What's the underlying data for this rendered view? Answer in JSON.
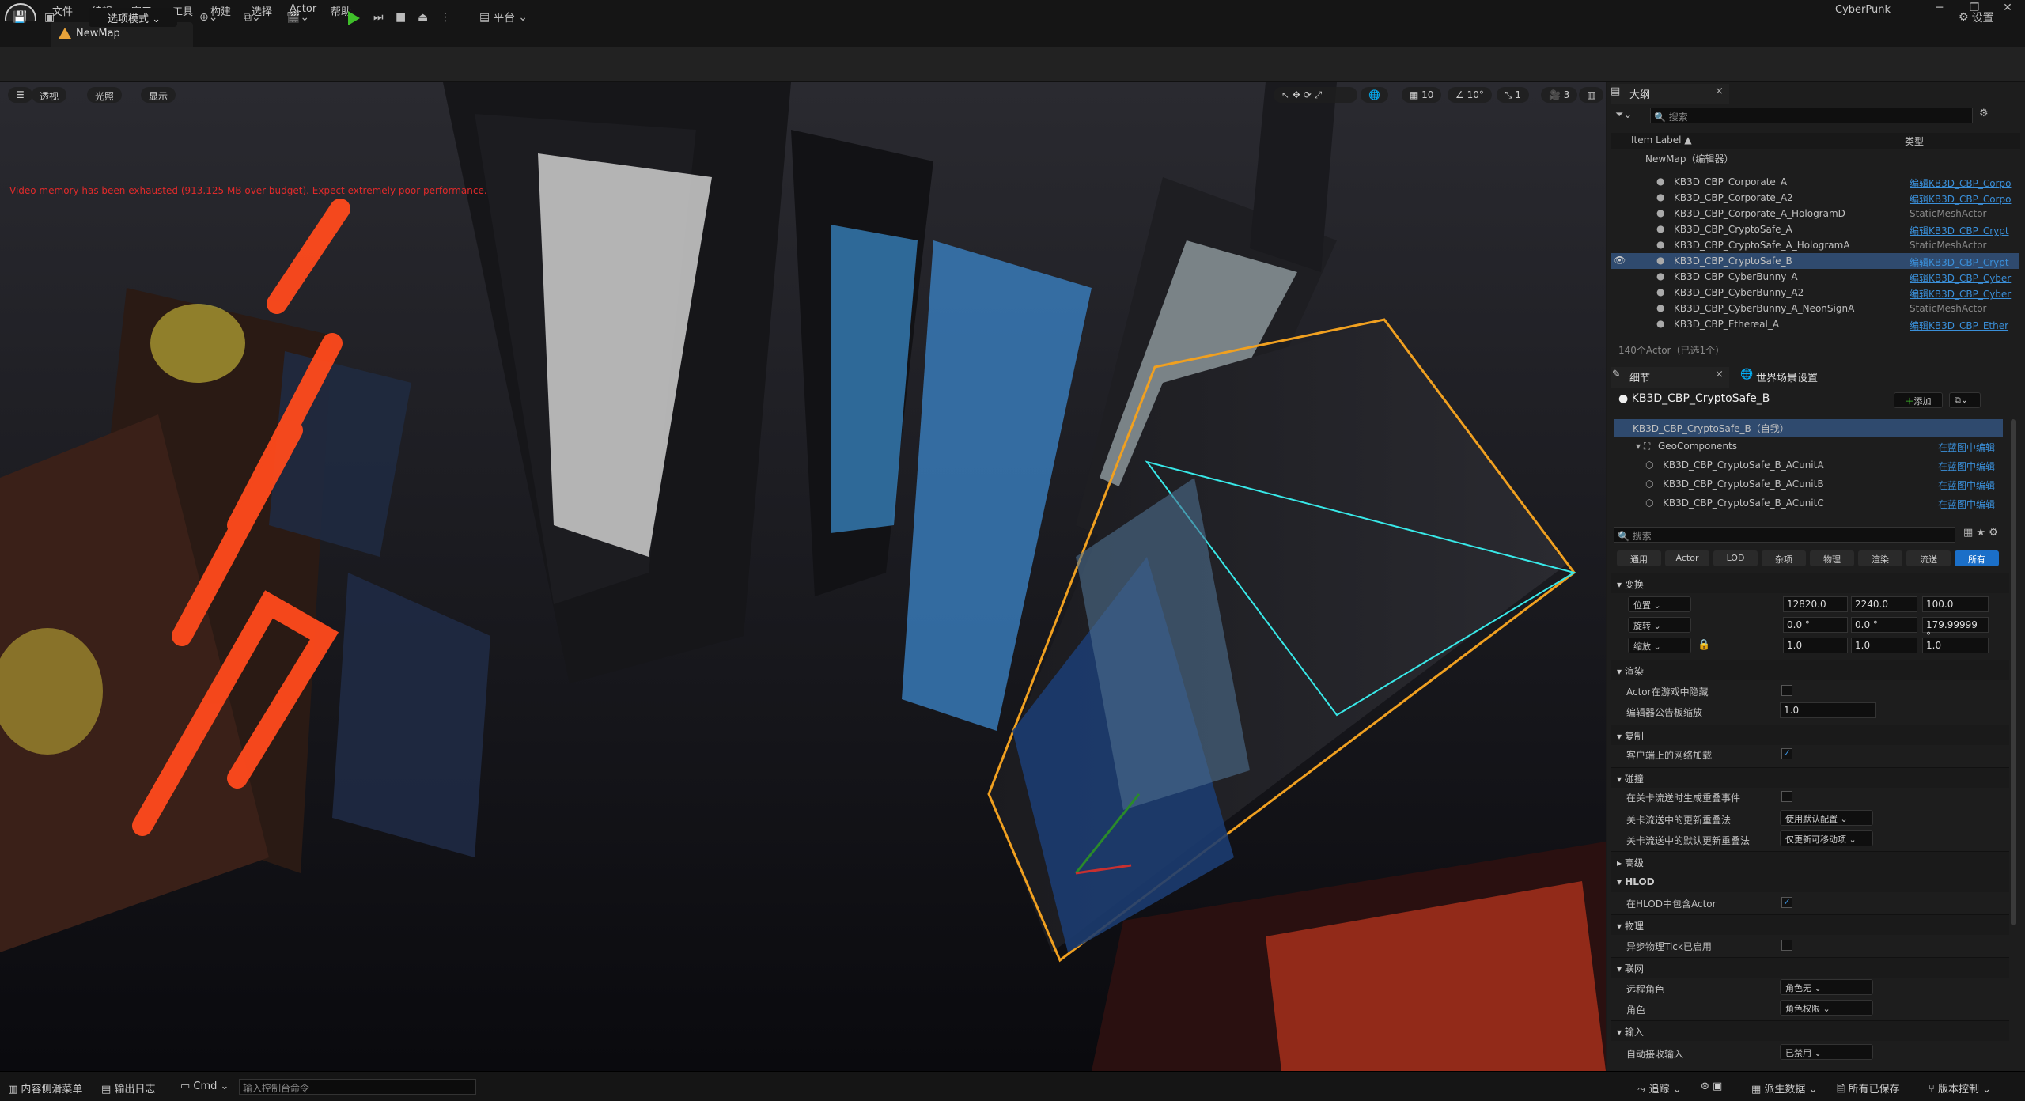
{
  "app": {
    "window_title": "CyberPunk",
    "map_tab": "NewMap"
  },
  "menu": [
    "文件",
    "编辑",
    "窗口",
    "工具",
    "构建",
    "选择",
    "Actor",
    "帮助"
  ],
  "window_buttons": [
    "─",
    "❐",
    "✕"
  ],
  "toolbar": {
    "mode_label": "选项模式",
    "platform_label": "平台",
    "settings_label": "设置"
  },
  "viewport": {
    "perspective": "透视",
    "lit": "光照",
    "show": "显示",
    "grid_snap": "10",
    "rot_snap": "10°",
    "scale_snap": "1",
    "cam_speed": "3",
    "warning": "Video memory has been exhausted (913.125 MB over budget). Expect extremely poor performance."
  },
  "outliner": {
    "title": "大纲",
    "search_placeholder": "搜索",
    "col_label": "Item Label ▲",
    "col_type": "类型",
    "root": "NewMap（编辑器）",
    "rows": [
      {
        "label": "KB3D_CBP_Corporate_A",
        "type": "编辑KB3D_CBP_Corpo",
        "link": true,
        "sel": false
      },
      {
        "label": "KB3D_CBP_Corporate_A2",
        "type": "编辑KB3D_CBP_Corpo",
        "link": true,
        "sel": false
      },
      {
        "label": "KB3D_CBP_Corporate_A_HologramD",
        "type": "StaticMeshActor",
        "link": false,
        "sel": false
      },
      {
        "label": "KB3D_CBP_CryptoSafe_A",
        "type": "编辑KB3D_CBP_Crypt",
        "link": true,
        "sel": false
      },
      {
        "label": "KB3D_CBP_CryptoSafe_A_HologramA",
        "type": "StaticMeshActor",
        "link": false,
        "sel": false
      },
      {
        "label": "KB3D_CBP_CryptoSafe_B",
        "type": "编辑KB3D_CBP_Crypt",
        "link": true,
        "sel": true
      },
      {
        "label": "KB3D_CBP_CyberBunny_A",
        "type": "编辑KB3D_CBP_Cyber",
        "link": true,
        "sel": false
      },
      {
        "label": "KB3D_CBP_CyberBunny_A2",
        "type": "编辑KB3D_CBP_Cyber",
        "link": true,
        "sel": false
      },
      {
        "label": "KB3D_CBP_CyberBunny_A_NeonSignA",
        "type": "StaticMeshActor",
        "link": false,
        "sel": false
      },
      {
        "label": "KB3D_CBP_Ethereal_A",
        "type": "编辑KB3D_CBP_Ether",
        "link": true,
        "sel": false
      }
    ],
    "count": "140个Actor（已选1个）"
  },
  "details": {
    "tab": "细节",
    "world_tab": "世界场景设置",
    "actor_name": "KB3D_CBP_CryptoSafe_B",
    "add_label": "添加",
    "self_row": "KB3D_CBP_CryptoSafe_B（自我）",
    "components": [
      {
        "label": "GeoComponents",
        "link": "在蓝图中编辑"
      },
      {
        "label": "KB3D_CBP_CryptoSafe_B_ACunitA",
        "link": "在蓝图中编辑"
      },
      {
        "label": "KB3D_CBP_CryptoSafe_B_ACunitB",
        "link": "在蓝图中编辑"
      },
      {
        "label": "KB3D_CBP_CryptoSafe_B_ACunitC",
        "link": "在蓝图中编辑"
      }
    ],
    "search_placeholder": "搜索",
    "filters": [
      "通用",
      "Actor",
      "LOD",
      "杂项",
      "物理",
      "渲染",
      "流送",
      "所有"
    ],
    "sec_transform": "变换",
    "location_label": "位置",
    "location": [
      "12820.0",
      "2240.0",
      "100.0"
    ],
    "rotation_label": "旋转",
    "rotation": [
      "0.0 °",
      "0.0 °",
      "179.99999 °"
    ],
    "scale_label": "缩放",
    "scale": [
      "1.0",
      "1.0",
      "1.0"
    ],
    "sec_render": "渲染",
    "hidden_label": "Actor在游戏中隐藏",
    "billboard_label": "编辑器公告板缩放",
    "billboard": "1.0",
    "sec_replication": "复制",
    "net_load_label": "客户端上的网络加载",
    "sec_collision": "碰撞",
    "overlap_label": "在关卡流送时生成重叠事件",
    "update_label": "关卡流送中的更新重叠法",
    "update_value": "使用默认配置",
    "default_update_label": "关卡流送中的默认更新重叠法",
    "default_update_value": "仅更新可移动项",
    "sec_advanced": "高级",
    "sec_hlod": "HLOD",
    "hlod_label": "在HLOD中包含Actor",
    "sec_physics": "物理",
    "async_label": "异步物理Tick已启用",
    "sec_network": "联网",
    "remote_role_label": "远程角色",
    "remote_role": "角色无",
    "role_label": "角色",
    "role": "角色权限",
    "sec_input": "输入",
    "auto_input_label": "自动接收输入",
    "auto_input": "已禁用"
  },
  "status": {
    "content_drawer": "内容侧滑菜单",
    "output_log": "输出日志",
    "cmd": "Cmd",
    "cmd_placeholder": "输入控制台命令",
    "trace": "追踪",
    "derived": "派生数据",
    "saved": "所有已保存",
    "source_control": "版本控制"
  },
  "colors": {
    "accent": "#3a8fd9",
    "selection": "#f0a020",
    "neon_red": "#ff4a1c",
    "play": "#3fbf2a"
  }
}
